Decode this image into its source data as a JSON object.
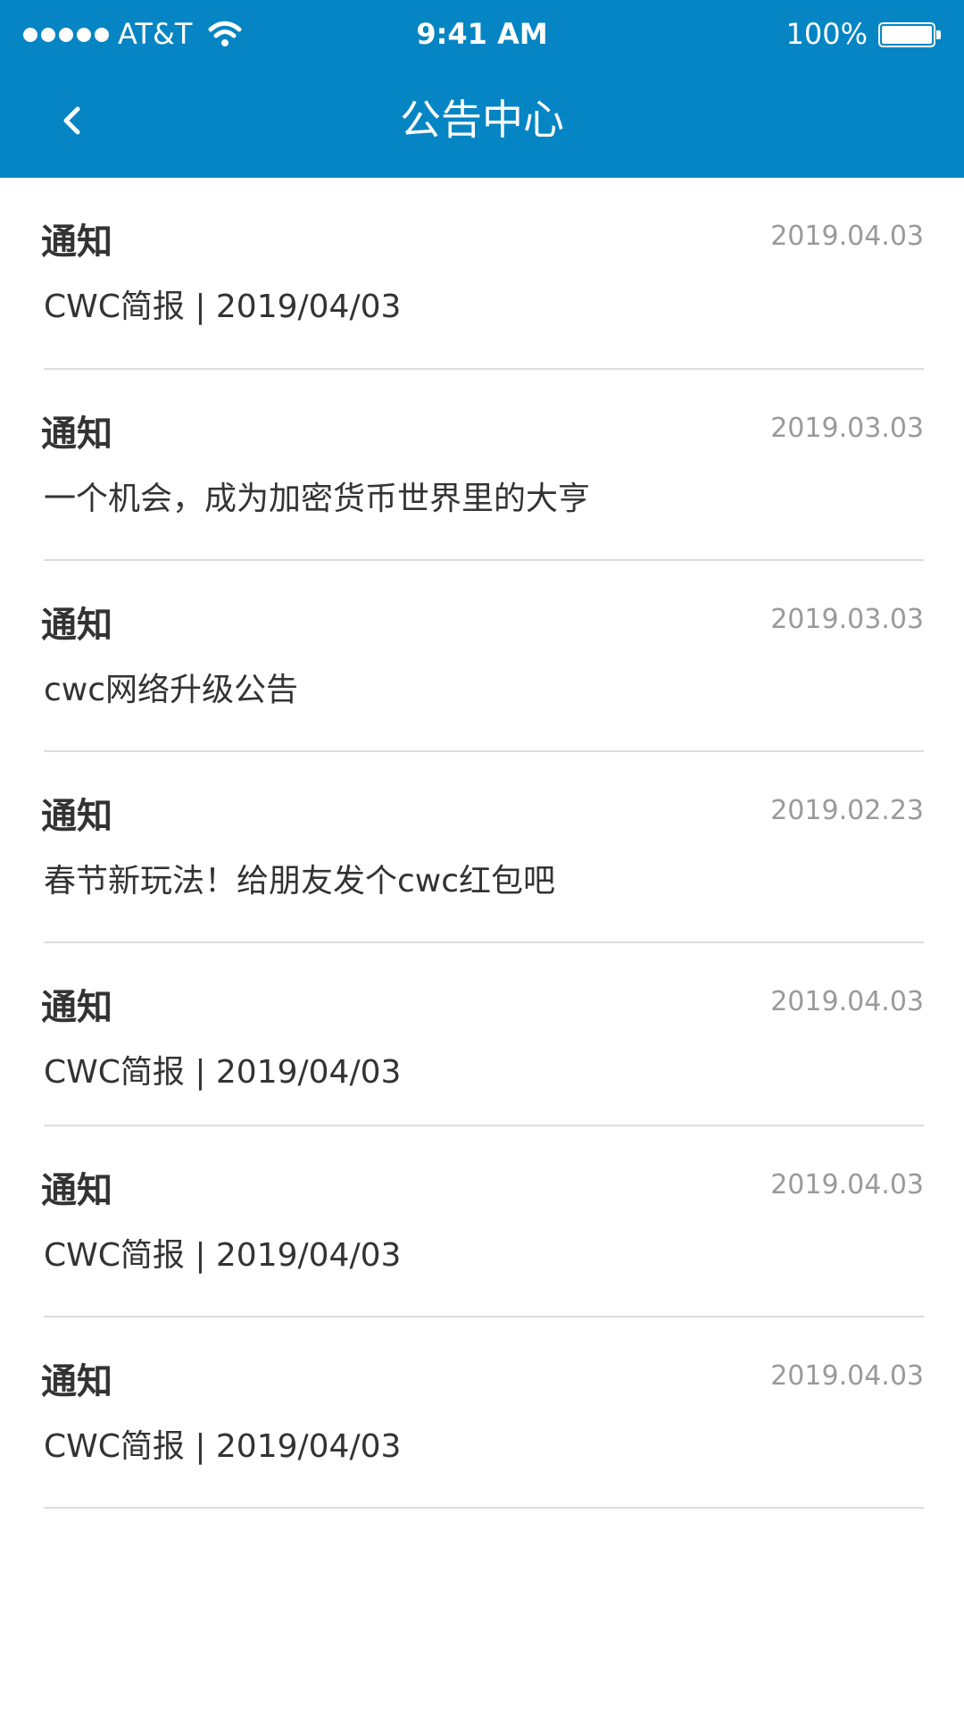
{
  "status_bar": {
    "carrier": "AT&T",
    "time": "9:41 AM",
    "battery": "100%"
  },
  "nav": {
    "title": "公告中心"
  },
  "notices": [
    {
      "title": "通知",
      "date": "2019.04.03",
      "content": "CWC简报 | 2019/04/03"
    },
    {
      "title": "通知",
      "date": "2019.03.03",
      "content": "一个机会，成为加密货币世界里的大亨"
    },
    {
      "title": "通知",
      "date": "2019.03.03",
      "content": "cwc网络升级公告"
    },
    {
      "title": "通知",
      "date": "2019.02.23",
      "content": "春节新玩法！给朋友发个cwc红包吧"
    },
    {
      "title": "通知",
      "date": "2019.04.03",
      "content": "CWC简报 | 2019/04/03"
    },
    {
      "title": "通知",
      "date": "2019.04.03",
      "content": "CWC简报 | 2019/04/03"
    },
    {
      "title": "通知",
      "date": "2019.04.03",
      "content": "CWC简报 | 2019/04/03"
    }
  ],
  "colors": {
    "header": "#0585C3",
    "divider": "#dddddd",
    "date": "#9a9a9a"
  }
}
